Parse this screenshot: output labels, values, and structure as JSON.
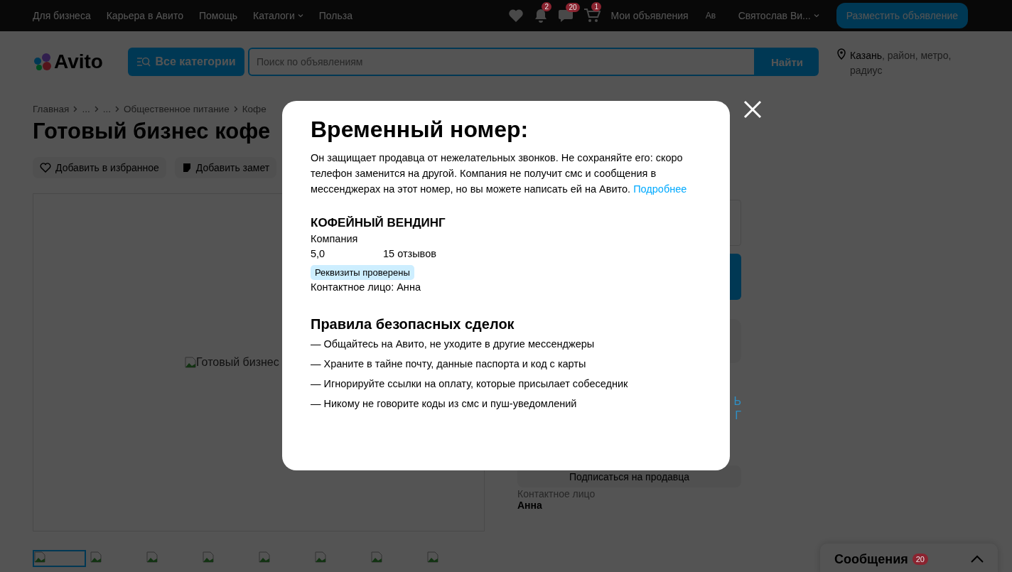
{
  "top_nav": {
    "links": [
      {
        "label": "Для бизнеса",
        "dropdown": false
      },
      {
        "label": "Карьера в Авито",
        "dropdown": false
      },
      {
        "label": "Помощь",
        "dropdown": false
      },
      {
        "label": "Каталоги",
        "dropdown": true
      },
      {
        "label": "Польза",
        "dropdown": false
      }
    ],
    "notifications_count": "2",
    "messages_count": "20",
    "cart_count": "1",
    "my_ads": "Мои объявления",
    "avatar_alt": "Ав",
    "user_name": "Святослав Ви...",
    "post_button": "Разместить объявление"
  },
  "header": {
    "logo": "Avito",
    "categories_button": "Все категории",
    "search_placeholder": "Поиск по объявлениям",
    "search_button": "Найти",
    "location": "**Казань**, район, метро, радиус"
  },
  "breadcrumbs": [
    "Главная",
    "...",
    "...",
    "Общественное питание",
    "Кофе"
  ],
  "title": "Готовый бизнес кофе",
  "actions": [
    {
      "kind": "heart",
      "label": "Добавить в избранное"
    },
    {
      "kind": "note",
      "label": "Добавить замет"
    }
  ],
  "gallery": {
    "image_alt": "Готовый бизнес",
    "thumbnails": [
      {
        "selected": true
      },
      {
        "selected": false
      },
      {
        "selected": false
      },
      {
        "selected": false
      },
      {
        "selected": false
      },
      {
        "selected": false
      },
      {
        "selected": false
      },
      {
        "selected": false
      }
    ]
  },
  "sidebar": {
    "blue_texts": [
      "Ь",
      "Г"
    ],
    "subscribe_button": "Подписаться на продавца",
    "contact_label": "Контактное лицо",
    "contact_name": "Анна"
  },
  "messenger": {
    "title": "Сообщения",
    "count": "20",
    "expanded": false
  },
  "modal": {
    "title": "Временный номер:",
    "text": "Он защищает продавца от нежелательных звонков. Не сохраняйте его: скоро телефон заменится на другой. Компания не получит смс и сообщения в мессенджерах на этот номер, но вы можете написать ей на Авито.",
    "link": "Подробнее",
    "seller": {
      "name": "КОФЕЙНЫЙ ВЕНДИНГ",
      "type": "Компания",
      "rating": "5,0",
      "reviews": "15 отзывов",
      "badge": "Реквизиты проверены",
      "contact": "Контактное лицо: Анна"
    },
    "rules": {
      "title": "Правила безопасных сделок",
      "items": [
        "— Общайтесь на Авито, не уходите в другие мессенджеры",
        "— Храните в тайне почту, данные паспорта и код с карты",
        "— Игнорируйте ссылки на оплату, которые присылает собеседник",
        "— Никому не говорите коды из смс и пуш-уведомлений"
      ]
    }
  }
}
